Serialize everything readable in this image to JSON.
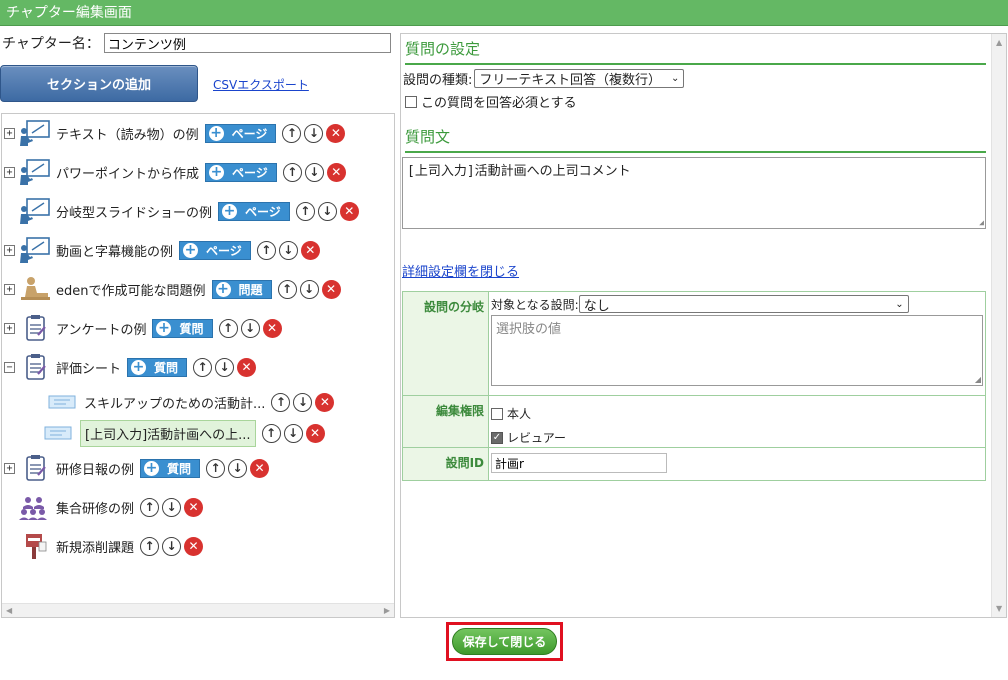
{
  "window": {
    "title": "チャプター編集画面"
  },
  "chapter": {
    "label": "チャプター名：",
    "value": "コンテンツ例"
  },
  "actions": {
    "add_section": "セクションの追加",
    "csv_export": "CSVエクスポート"
  },
  "tree": {
    "items": [
      {
        "label": "テキスト（読み物）の例",
        "expander": "+",
        "icon": "presentation-icon",
        "add_label": "ページ"
      },
      {
        "label": "パワーポイントから作成",
        "expander": "+",
        "icon": "presentation-icon",
        "add_label": "ページ"
      },
      {
        "label": "分岐型スライドショーの例",
        "expander": "",
        "icon": "presentation-icon",
        "add_label": "ページ"
      },
      {
        "label": "動画と字幕機能の例",
        "expander": "+",
        "icon": "presentation-icon",
        "add_label": "ページ"
      },
      {
        "label": "edenで作成可能な問題例",
        "expander": "+",
        "icon": "desk-person-icon",
        "add_label": "問題"
      },
      {
        "label": "アンケートの例",
        "expander": "+",
        "icon": "clipboard-icon",
        "add_label": "質問"
      },
      {
        "label": "評価シート",
        "expander": "−",
        "icon": "clipboard-icon",
        "add_label": "質問"
      },
      {
        "label": "スキルアップのための活動計...",
        "expander": "",
        "icon": "ticket-icon",
        "add_label": ""
      },
      {
        "label": "[上司入力]活動計画への上...",
        "expander": "",
        "icon": "ticket-icon",
        "add_label": "",
        "selected": true
      },
      {
        "label": "研修日報の例",
        "expander": "+",
        "icon": "clipboard-icon",
        "add_label": "質問"
      },
      {
        "label": "集合研修の例",
        "expander": "",
        "icon": "group-icon",
        "add_label": ""
      },
      {
        "label": "新規添削課題",
        "expander": "",
        "icon": "post-box-icon",
        "add_label": ""
      }
    ]
  },
  "question_settings": {
    "heading": "質問の設定",
    "type_label": "設問の種類:",
    "type_value": "フリーテキスト回答（複数行）",
    "required_label": "この質問を回答必須とする"
  },
  "question_text": {
    "heading": "質問文",
    "value": "[上司入力]活動計画への上司コメント"
  },
  "detail": {
    "toggle_link": "詳細設定欄を閉じる",
    "branch_label": "設問の分岐",
    "target_label": "対象となる設問:",
    "target_value": "なし",
    "choice_placeholder": "選択肢の値",
    "permission_label": "編集権限",
    "perm_self": "本人",
    "perm_reviewer": "レビュアー",
    "id_label": "設問ID",
    "id_value": "計画r"
  },
  "footer": {
    "save_close": "保存して閉じる"
  }
}
